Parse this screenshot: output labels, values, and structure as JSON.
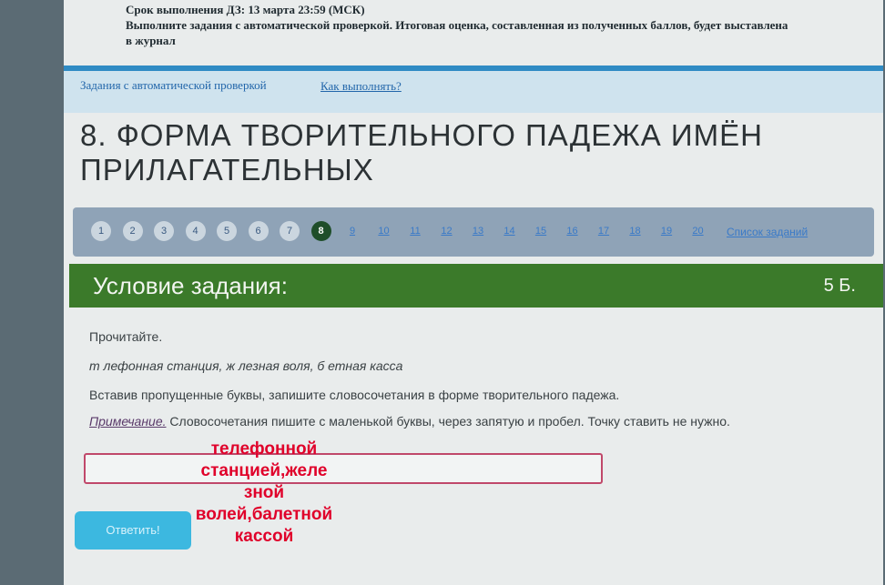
{
  "deadline": {
    "line1": "Срок выполнения ДЗ: 13 марта 23:59 (МСК)",
    "line2": "Выполните задания с автоматической проверкой. Итоговая оценка, составленная из полученных баллов, будет выставлена",
    "line3": "в журнал"
  },
  "auto_bar": {
    "text": "Задания с автоматической проверкой",
    "link": "Как выполнять?"
  },
  "title": "8. Форма творительного падежа имён прилагательных",
  "pager": {
    "items": [
      "1",
      "2",
      "3",
      "4",
      "5",
      "6",
      "7",
      "8",
      "9",
      "10",
      "11",
      "12",
      "13",
      "14",
      "15",
      "16",
      "17",
      "18",
      "19",
      "20"
    ],
    "current": "8",
    "list_link": "Список заданий"
  },
  "condition": {
    "label": "Условие задания:",
    "points": "5 Б."
  },
  "task": {
    "read": "Прочитайте.",
    "phrases": "т лефонная станция, ж лезная воля, б  етная касса",
    "instruction": "Вставив пропущенные буквы, запишите словосочетания в форме творительного падежа.",
    "note_label": "Примечание.",
    "note_text": " Словосочетания пишите с маленькой буквы, через запятую и пробел. Точку ставить не нужно."
  },
  "answer": {
    "value": "",
    "submit_label": "Ответить!"
  },
  "overlay": {
    "lines": [
      "телефонной",
      "станцией,желе",
      "зной",
      "волей,балетной",
      "кассой"
    ]
  },
  "colors": {
    "accent_blue": "#2f8bc4",
    "condition_green": "#3b7a2a",
    "current_page": "#1f4e2a",
    "overlay_red": "#e0002a",
    "field_border": "#c0486a",
    "submit_bg": "#3cb8e0"
  }
}
